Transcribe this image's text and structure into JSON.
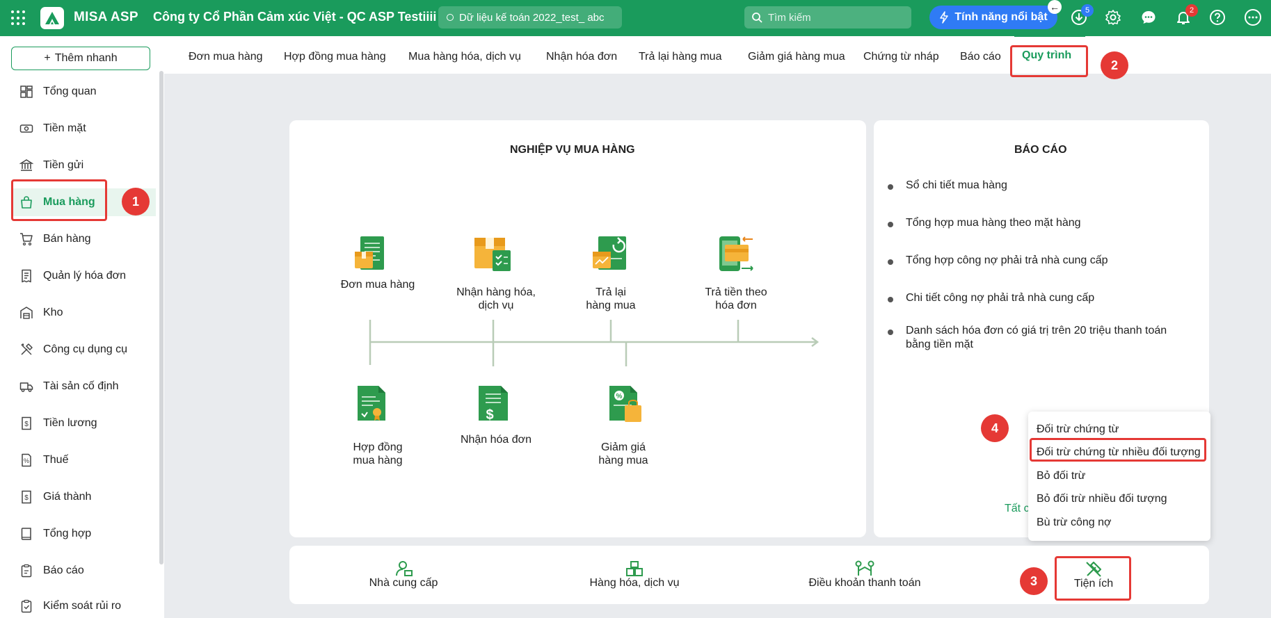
{
  "topbar": {
    "app_name": "MISA ASP",
    "company": "Công ty Cổ Phần Cảm xúc Việt - QC ASP Testiiii",
    "database": "Dữ liệu kế toán 2022_test_ abc",
    "search_placeholder": "Tìm kiếm",
    "feature_button": "Tính năng nổi bật",
    "download_badge": "5",
    "notification_badge": "2",
    "back_arrow": "←"
  },
  "sidebar": {
    "quick_add": "Thêm nhanh",
    "quick_add_icon": "+",
    "items": [
      {
        "label": "Tổng quan",
        "icon": "dashboard-icon"
      },
      {
        "label": "Tiền mặt",
        "icon": "cash-icon"
      },
      {
        "label": "Tiền gửi",
        "icon": "bank-icon"
      },
      {
        "label": "Mua hàng",
        "icon": "shopping-bag-icon"
      },
      {
        "label": "Bán hàng",
        "icon": "cart-icon"
      },
      {
        "label": "Quản lý hóa đơn",
        "icon": "invoice-icon"
      },
      {
        "label": "Kho",
        "icon": "warehouse-icon"
      },
      {
        "label": "Công cụ dụng cụ",
        "icon": "tools-icon"
      },
      {
        "label": "Tài sản cố định",
        "icon": "truck-icon"
      },
      {
        "label": "Tiền lương",
        "icon": "salary-icon"
      },
      {
        "label": "Thuế",
        "icon": "tax-icon"
      },
      {
        "label": "Giá thành",
        "icon": "cost-icon"
      },
      {
        "label": "Tổng hợp",
        "icon": "book-icon"
      },
      {
        "label": "Báo cáo",
        "icon": "report-icon"
      },
      {
        "label": "Kiểm soát rủi ro",
        "icon": "risk-icon"
      }
    ]
  },
  "tabs": [
    "Đơn mua hàng",
    "Hợp đồng mua hàng",
    "Mua hàng hóa, dịch vụ",
    "Nhận hóa đơn",
    "Trả lại hàng mua",
    "Giảm giá hàng mua",
    "Chứng từ nháp",
    "Báo cáo",
    "Quy trình"
  ],
  "process": {
    "title": "NGHIỆP VỤ MUA HÀNG",
    "top_nodes": [
      "Đơn mua hàng",
      "Nhận hàng hóa,\ndịch vụ",
      "Trả lại\nhàng mua",
      "Trả tiền theo\nhóa đơn"
    ],
    "bottom_nodes": [
      "Hợp đồng\nmua hàng",
      "Nhận hóa đơn",
      "Giảm giá\nhàng mua"
    ]
  },
  "reports": {
    "title": "BÁO CÁO",
    "items": [
      "Sổ chi tiết mua hàng",
      "Tổng hợp mua hàng theo mặt hàng",
      "Tổng hợp công nợ phải trả nhà cung cấp",
      "Chi tiết công nợ phải trả nhà cung cấp",
      "Danh sách hóa đơn có giá trị trên 20 triệu thanh toán bằng tiền mặt"
    ],
    "all_link": "Tất c"
  },
  "utility_menu": [
    "Đối trừ chứng từ",
    "Đối trừ chứng từ nhiều đối tượng",
    "Bỏ đối trừ",
    "Bỏ đối trừ nhiều đối tượng",
    "Bù trừ công nợ"
  ],
  "bottom_bar": [
    "Nhà cung cấp",
    "Hàng hóa, dịch vụ",
    "Điều khoản thanh toán",
    "Tiện ích"
  ],
  "annotations": [
    "1",
    "2",
    "3",
    "4"
  ],
  "colors": {
    "brand": "#1a9b5c",
    "highlight": "#e53935",
    "feature": "#2f7bf5"
  }
}
